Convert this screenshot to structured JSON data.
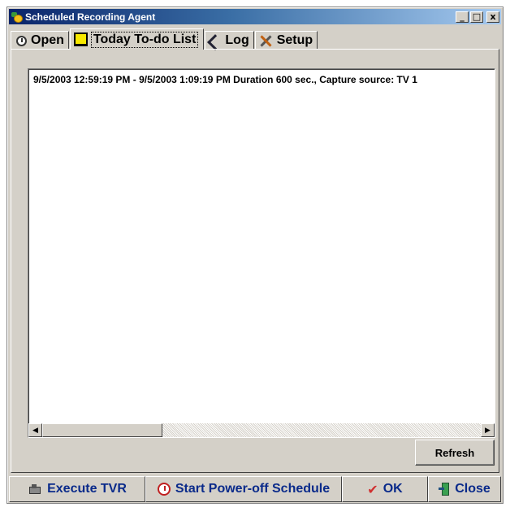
{
  "window": {
    "title": "Scheduled Recording Agent",
    "controls": {
      "minimize": "_",
      "maximize": "□",
      "close": "x"
    }
  },
  "tabs": [
    {
      "label": "Open",
      "icon": "clock-open-icon",
      "active": false
    },
    {
      "label": "Today To-do List",
      "icon": "note-icon",
      "active": true
    },
    {
      "label": "Log",
      "icon": "log-check-icon",
      "active": false
    },
    {
      "label": "Setup",
      "icon": "tools-icon",
      "active": false
    }
  ],
  "todo_list": {
    "items": [
      "9/5/2003 12:59:19 PM - 9/5/2003 1:09:19 PM Duration 600 sec., Capture source: TV 1"
    ],
    "scroll_left_glyph": "◀",
    "scroll_right_glyph": "▶"
  },
  "refresh_label": "Refresh",
  "bottom_buttons": {
    "execute": "Execute TVR",
    "power_off": "Start Power-off Schedule",
    "ok": "OK",
    "ok_glyph": "✔",
    "close": "Close"
  },
  "colors": {
    "window_bg": "#d4d0c8",
    "title_start": "#0a246a",
    "title_end": "#a6caf0",
    "button_text": "#0a2a8a"
  }
}
